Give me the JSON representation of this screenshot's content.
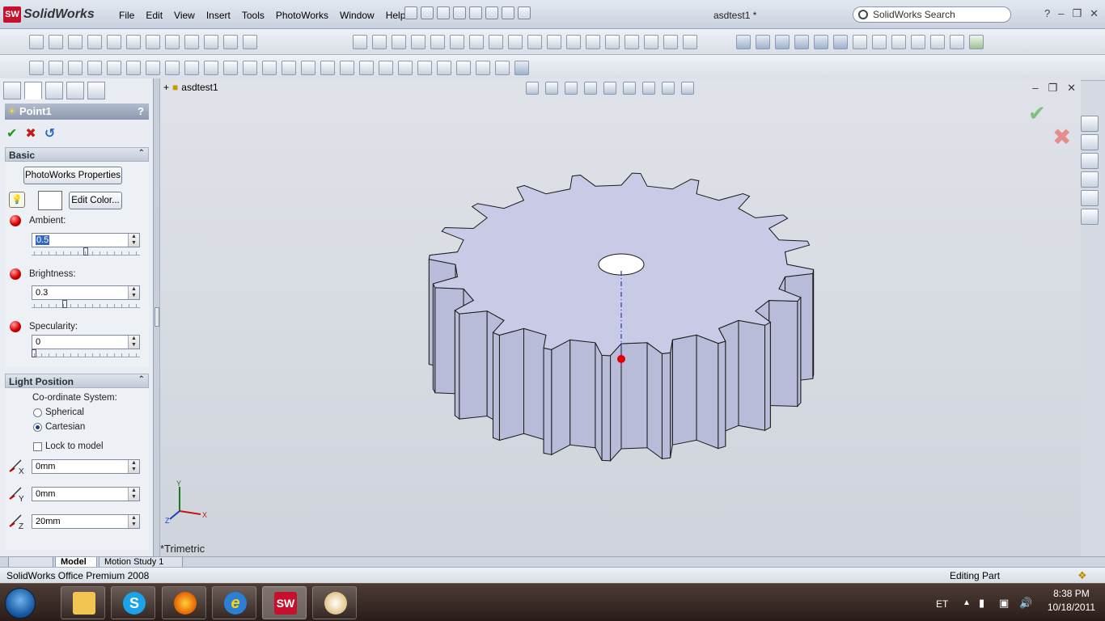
{
  "app": {
    "logo_text": "SolidWorks",
    "logo_badge": "SW",
    "document_title": "asdtest1 *",
    "search_placeholder": "SolidWorks Search"
  },
  "menu": [
    "File",
    "Edit",
    "View",
    "Insert",
    "Tools",
    "PhotoWorks",
    "Window",
    "Help"
  ],
  "property_manager": {
    "title": "Point1",
    "help": "?",
    "basic_group": {
      "title": "Basic",
      "photoworks_button": "PhotoWorks Properties",
      "edit_color_button": "Edit Color...",
      "ambient_label": "Ambient:",
      "ambient_value": "0.5",
      "ambient_level": 0.5,
      "brightness_label": "Brightness:",
      "brightness_value": "0.3",
      "brightness_level": 0.3,
      "specularity_label": "Specularity:",
      "specularity_value": "0",
      "specularity_level": 0
    },
    "light_position_group": {
      "title": "Light Position",
      "coordinate_label": "Co-ordinate System:",
      "spherical_label": "Spherical",
      "cartesian_label": "Cartesian",
      "selected_coordinate": "Cartesian",
      "lock_label": "Lock to model",
      "lock_checked": false,
      "x_label": "X",
      "x_value": "0mm",
      "y_label": "Y",
      "y_value": "0mm",
      "z_label": "Z",
      "z_value": "20mm"
    }
  },
  "feature_tree": {
    "root": "asdtest1"
  },
  "viewport": {
    "view_name": "*Trimetric",
    "model": "spur-gear",
    "gear_teeth": 20,
    "triad_labels": {
      "y": "Y",
      "x": "X",
      "z": "Z"
    }
  },
  "bottom_tabs": [
    "Model",
    "Motion Study 1"
  ],
  "active_bottom_tab": "Model",
  "status": {
    "left": "SolidWorks Office Premium 2008",
    "right": "Editing Part"
  },
  "taskbar": {
    "language": "ET",
    "time": "8:38 PM",
    "date": "10/18/2011",
    "apps": [
      "Windows Explorer",
      "Skype",
      "Firefox",
      "Internet Explorer",
      "SolidWorks",
      "Paint"
    ]
  },
  "colors": {
    "accent": "#3168c6",
    "model_face": "#c9cbe6",
    "model_edge": "#1a1a1a",
    "sketch_line": "#1f3db8",
    "point": "#e00000"
  }
}
